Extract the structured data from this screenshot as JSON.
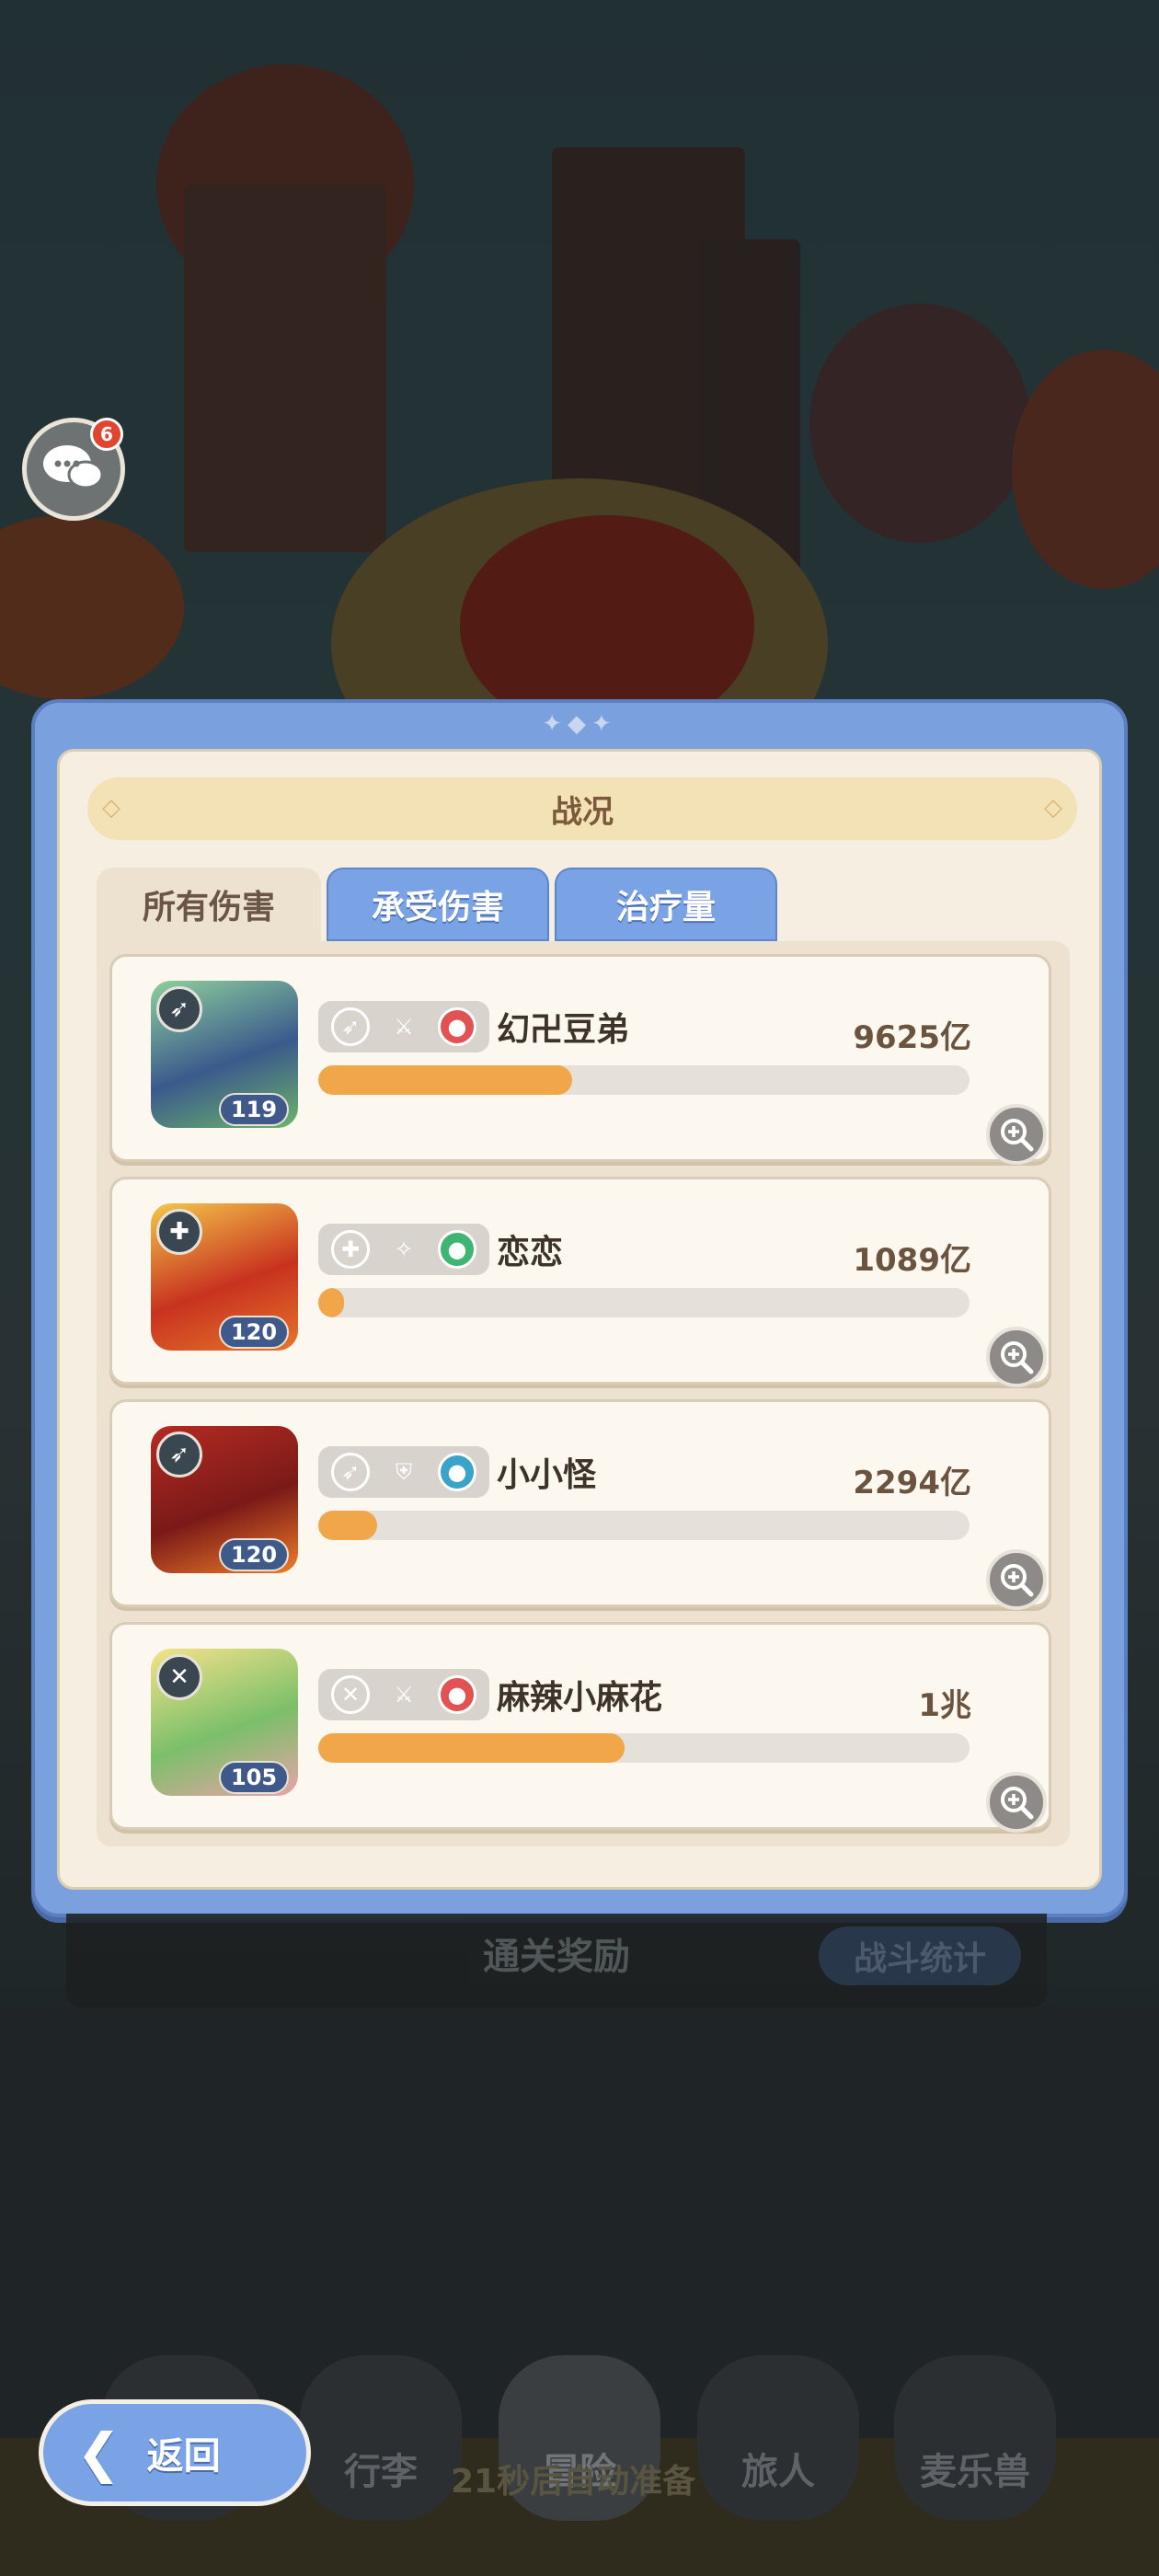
{
  "chat": {
    "badge_count": "6"
  },
  "panel": {
    "title": "战况",
    "tabs": [
      {
        "label": "所有伤害",
        "active": true
      },
      {
        "label": "承受伤害",
        "active": false
      },
      {
        "label": "治疗量",
        "active": false
      }
    ],
    "rows": [
      {
        "name": "幻卍豆弟",
        "value": "9625亿",
        "level": "119",
        "progress": 0.39,
        "element_color": "#e35252"
      },
      {
        "name": "恋恋",
        "value": "1089亿",
        "level": "120",
        "progress": 0.04,
        "element_color": "#3fb573"
      },
      {
        "name": "小小怪",
        "value": "2294亿",
        "level": "120",
        "progress": 0.09,
        "element_color": "#3aa3c9"
      },
      {
        "name": "麻辣小麻花",
        "value": "1兆",
        "level": "105",
        "progress": 0.47,
        "element_color": "#e35252"
      }
    ]
  },
  "footer": {
    "title": "通关奖励",
    "stats_button": "战斗统计"
  },
  "nav": {
    "items": [
      "行李",
      "冒险",
      "旅人",
      "麦乐兽"
    ],
    "auto_text": "21秒后自动准备",
    "back_label": "返回"
  },
  "colors": {
    "accent_blue": "#7aa3e6",
    "bar_fill": "#f1a64a",
    "panel_bg": "#f6efe1"
  }
}
